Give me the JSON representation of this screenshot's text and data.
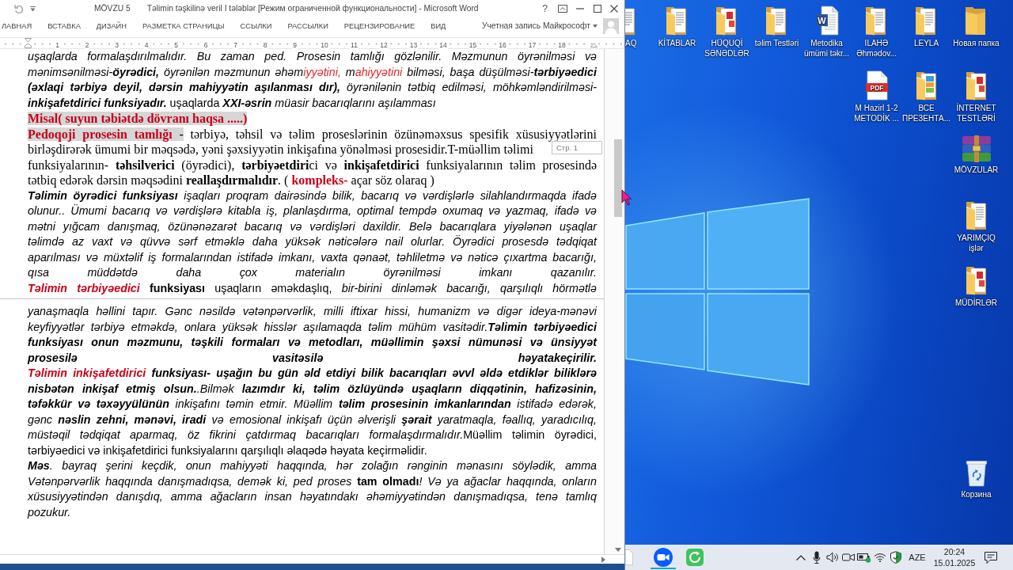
{
  "window": {
    "document_name": "MÖVZU 5",
    "title": "Təlimin təşkilinə veril I tələblər [Режим ограниченной функциональности] - Microsoft Word",
    "help": "?"
  },
  "ribbon_tabs": [
    {
      "label": "ЛАВНАЯ",
      "selected": false
    },
    {
      "label": "ВСТАВКА",
      "selected": false
    },
    {
      "label": "ДИЗАЙН",
      "selected": false
    },
    {
      "label": "РАЗМЕТКА СТРАНИЦЫ",
      "selected": false
    },
    {
      "label": "ССЫЛКИ",
      "selected": false
    },
    {
      "label": "РАССЫЛКИ",
      "selected": false
    },
    {
      "label": "РЕЦЕНЗИРОВАНИЕ",
      "selected": false
    },
    {
      "label": "ВИД",
      "selected": false
    }
  ],
  "account": {
    "label": "Учетная запись Майкрософт"
  },
  "ruler": [
    "1",
    "2",
    "3",
    "4",
    "5",
    "6",
    "7",
    "8",
    "9",
    "10",
    "11",
    "12",
    "13",
    "14",
    "15",
    "16",
    "17",
    "18"
  ],
  "document": {
    "pages": [
      {
        "paragraphs": [
          {
            "kind": "body",
            "continues_on_next_page": false,
            "lines": [
              {
                "runs": [
                  {
                    "kind": "italic",
                    "text": "uşaqlarda formalaşdırılmalıdır. Bu zaman ped. Prosesin tamlığı gözlənilir. Məzmunun öyrənilməsi və"
                  }
                ]
              },
              {
                "runs": [
                  {
                    "kind": "italic",
                    "text": "mənimsənilməsi-"
                  },
                  {
                    "kind": "bold-italic",
                    "text": "öyrədici,"
                  },
                  {
                    "kind": "italic",
                    "text": " öyrənilən məzmunun əhəm"
                  },
                  {
                    "kind": "red-italic",
                    "text": "iyyətini,"
                  },
                  {
                    "kind": "italic",
                    "text": " m"
                  },
                  {
                    "kind": "red-italic",
                    "text": "ahiyyətini"
                  },
                  {
                    "kind": "italic",
                    "text": " bilməsi, başa düşülməsi-"
                  },
                  {
                    "kind": "bold-italic",
                    "text": "tərbiyəedici"
                  }
                ]
              },
              {
                "runs": [
                  {
                    "kind": "bold-italic",
                    "text": "(əxlaqi tərbiyə deyil, dərsin mahiyyətin aşılanması dır),"
                  },
                  {
                    "kind": "italic",
                    "text": " öyrənilənin tətbiq edilməsi, möhkəmləndirilməsi-"
                  }
                ]
              },
              {
                "runs": [
                  {
                    "kind": "bold-italic",
                    "text": "inkişafetdirici funksiyadır."
                  },
                  {
                    "kind": "regular",
                    "text": " uşaqlarda "
                  },
                  {
                    "kind": "bold-italic",
                    "text": "XXI-əsrin"
                  },
                  {
                    "kind": "italic",
                    "text": " müasir bacarıqlarını aşılamması"
                  }
                ]
              }
            ]
          },
          {
            "kind": "example",
            "continues_on_next_page": false,
            "lines": [
              {
                "runs": [
                  {
                    "kind": "red-bold-highlighted",
                    "text": "Misal( suyun təbiətdə dövranı haqsa .....)"
                  }
                ]
              }
            ]
          },
          {
            "kind": "definition",
            "continues_on_next_page": false,
            "lines": [
              {
                "runs": [
                  {
                    "kind": "red-bold-highlighted",
                    "text": "Pedoqoji prosesin tamlığı"
                  },
                  {
                    "kind": "highlighted",
                    "text": " -"
                  },
                  {
                    "kind": "regular",
                    "text": " tərbiyə, təhsil və təlim proseslərinin özünəməxsus spesifik xüsusiyyətlərini"
                  }
                ]
              },
              {
                "runs": [
                  {
                    "kind": "regular",
                    "text": "birləşdirərək ümumi bir məqsədə, yəni şəxsiyyətin inkişafına yönəlməsi prosesidir.T-müəllim təlimi"
                  }
                ],
                "tooltip": "Стр. 1"
              },
              {
                "runs": [
                  {
                    "kind": "regular",
                    "text": "funksiyalarının- "
                  },
                  {
                    "kind": "bold",
                    "text": "təhsilverici"
                  },
                  {
                    "kind": "regular",
                    "text": " (öyrədici), "
                  },
                  {
                    "kind": "bold",
                    "text": "tərbiyəetdiri"
                  },
                  {
                    "kind": "regular",
                    "text": "ci və "
                  },
                  {
                    "kind": "bold",
                    "text": "inkişafetdirici"
                  },
                  {
                    "kind": "regular",
                    "text": " funksiyalarının təlim prosesində"
                  }
                ]
              },
              {
                "runs": [
                  {
                    "kind": "regular",
                    "text": "tətbiq edərək dərsin məqsədini "
                  },
                  {
                    "kind": "bold",
                    "text": "reallaşdırmalıdır"
                  },
                  {
                    "kind": "regular",
                    "text": ". ( "
                  },
                  {
                    "kind": "red-bold",
                    "text": "kompleks-"
                  },
                  {
                    "kind": "regular",
                    "text": " açar söz olaraq )"
                  }
                ]
              }
            ]
          },
          {
            "kind": "body",
            "continues_on_next_page": true,
            "lines": [
              {
                "runs": [
                  {
                    "kind": "bold-italic",
                    "text": "Təlimin öyrədici funksiyası"
                  },
                  {
                    "kind": "italic",
                    "text": " işaqları proqram dairəsində bilik, bacarıq və vərdişlərlə silahlandırmaqda ifadə"
                  }
                ]
              },
              {
                "runs": [
                  {
                    "kind": "italic",
                    "text": "olunur.. Ümumi bacarıq və vərdişlərə kitabla iş, planlaşdırma, optimal tempdə oxumaq və yazmaq, ifadə və"
                  }
                ]
              },
              {
                "runs": [
                  {
                    "kind": "italic",
                    "text": "mətni yığcam danışmaq, özünənəzarət bacarıq və vərdişləri daxildir. Belə bacarıqlara yiyələnən uşaqlar"
                  }
                ]
              },
              {
                "runs": [
                  {
                    "kind": "italic",
                    "text": "təlimdə az vaxt və qüvvə sərf etməklə daha yüksək nəticələrə nail olurlar. Öyrədici prosesdə tədqiqat"
                  }
                ]
              },
              {
                "runs": [
                  {
                    "kind": "italic",
                    "text": "aparılması və müxtəlif iş formalarından istifadə imkanı, vaxta qənaət, təhliletmə və nəticə çıxartma bacarığı,"
                  }
                ]
              },
              {
                "runs": [
                  {
                    "kind": "italic",
                    "text": "qısa müddətdə daha çox materialın öyrənilməsi imkanı qazanılır."
                  }
                ]
              },
              {
                "runs": [
                  {
                    "kind": "red-bold-italic",
                    "text": "Təlimin tərbiyəedici"
                  },
                  {
                    "kind": "bold",
                    "text": " funksiyası"
                  },
                  {
                    "kind": "regular",
                    "text": " uşaqların əməkdaşlıq,"
                  },
                  {
                    "kind": "italic",
                    "text": " bir-birini dinləmək bacarığı, qarşılıqlı hörmətlə"
                  }
                ]
              }
            ]
          }
        ]
      },
      {
        "paragraphs": [
          {
            "kind": "body",
            "continues_on_next_page": false,
            "lines": [
              {
                "runs": [
                  {
                    "kind": "italic",
                    "text": "yanaşmaqla həllini tapır. Gənc nəsildə vətənpərvərlik, milli iftixar hissi, humanizm və digər ideya-mənəvi"
                  }
                ]
              },
              {
                "runs": [
                  {
                    "kind": "italic",
                    "text": "keyfiyyətlər tərbiyə etməkdə, onlara yüksək hisslər aşılamaqda təlim mühüm vasitədir."
                  },
                  {
                    "kind": "bold-italic",
                    "text": "Təlimin tərbiyəedici"
                  }
                ]
              },
              {
                "runs": [
                  {
                    "kind": "bold-italic",
                    "text": "funksiyası onun məzmunu, təşkili formaları və metodları, müəllimin şəxsi nümunəsi və ünsiyyət"
                  }
                ]
              },
              {
                "runs": [
                  {
                    "kind": "bold-italic",
                    "text": "prosesilə vasitəsilə həyatakeçirilir."
                  }
                ]
              },
              {
                "runs": [
                  {
                    "kind": "red-bold-italic",
                    "text": "Təlimin inkişafetdirici"
                  },
                  {
                    "kind": "bold-italic",
                    "text": " funksiyası- uşağın bu gün əld etdiyi bilik bacarıqları əvvl əldə etdiklər biliklərə"
                  }
                ]
              },
              {
                "runs": [
                  {
                    "kind": "bold-italic",
                    "text": "nisbətən inkişaf etmiş olsun."
                  },
                  {
                    "kind": "italic",
                    "text": ".Bilmək "
                  },
                  {
                    "kind": "bold-italic",
                    "text": "lazımdır ki, təlim özlüyündə uşaqların diqqətinin, hafizəsinin,"
                  }
                ]
              },
              {
                "runs": [
                  {
                    "kind": "bold-italic",
                    "text": "təfəkkür və təxəyyülünün"
                  },
                  {
                    "kind": "italic",
                    "text": " inkişafını təmin etmir. Müəllim "
                  },
                  {
                    "kind": "bold-italic",
                    "text": "təlim prosesinin imkanlarından"
                  },
                  {
                    "kind": "italic",
                    "text": " istifadə edərək,"
                  }
                ]
              },
              {
                "runs": [
                  {
                    "kind": "italic",
                    "text": "gənc "
                  },
                  {
                    "kind": "bold-italic",
                    "text": "nəslin zehni, mənəvi, iradi"
                  },
                  {
                    "kind": "italic",
                    "text": " və emosional inkişafı üçün əlverişli "
                  },
                  {
                    "kind": "bold-italic",
                    "text": "şərait"
                  },
                  {
                    "kind": "italic",
                    "text": " yaratmaqla, fəallıq, yaradıcılıq,"
                  }
                ]
              },
              {
                "runs": [
                  {
                    "kind": "italic",
                    "text": "müstəqil tədqiqat aparmaq, öz fikrini çatdırmaq bacarıqları formalaşdırmalıdır."
                  },
                  {
                    "kind": "regular",
                    "text": "Müəllim təlimin öyrədici,"
                  }
                ]
              },
              {
                "runs": [
                  {
                    "kind": "regular",
                    "text": "tərbiyəedici və inkişafetdirici funksiyalarını qarşılıqlı əlaqədə həyata keçirməlidir."
                  }
                ]
              }
            ]
          },
          {
            "kind": "body",
            "continues_on_next_page": false,
            "lines": [
              {
                "runs": [
                  {
                    "kind": "bold-italic",
                    "text": "Məs"
                  },
                  {
                    "kind": "italic",
                    "text": ". bayraq şerini keçdik, onun mahiyyəti haqqında, hər zolağın rənginin mənasını söylədik, amma"
                  }
                ]
              },
              {
                "runs": [
                  {
                    "kind": "italic",
                    "text": "Vətənpərvərlik haqqında danışmadıqsa, demək ki, ped proses "
                  },
                  {
                    "kind": "bold",
                    "text": "tam olmadı"
                  },
                  {
                    "kind": "italic",
                    "text": "! Və ya ağaclar haqqında, onların"
                  }
                ]
              },
              {
                "runs": [
                  {
                    "kind": "italic",
                    "text": "xüsusiyyətindən danışdıq, amma ağacların insan həyatındakı əhəmiyyətindən danışmadıqsa, tenə tamlıq"
                  }
                ]
              },
              {
                "runs": [
                  {
                    "kind": "italic",
                    "text": "pozukur."
                  }
                ]
              }
            ]
          }
        ]
      }
    ]
  },
  "desktop": {
    "cut_icon": {
      "kind": "folder-docs",
      "label": "AQ"
    },
    "icon_rows": [
      [
        {
          "kind": "folder-docs",
          "label": "KİTABLAR"
        },
        {
          "kind": "folder-pdf",
          "label": "HÜQUQİ\nSƏNƏDLƏR"
        },
        {
          "kind": "folder-docs",
          "label": "təlim Testləri"
        },
        {
          "kind": "word-doc",
          "label": "Metodika\nümümi təkr...",
          "badge": "W"
        },
        {
          "kind": "folder-docs",
          "label": "ILAHƏ\nƏhmədov..."
        },
        {
          "kind": "folder-docs",
          "label": "LEYLA"
        },
        {
          "kind": "folder",
          "label": "Новая папка"
        }
      ],
      [
        {
          "kind": "pdf",
          "label": "M Hazirl 1-2\nMETODİK ...",
          "badge": "PDF"
        },
        {
          "kind": "folder-images",
          "label": "ВСЕ\nПРЕЗЕНТА..."
        },
        {
          "kind": "folder-pdf",
          "label": "İNTERNET\nTESTLƏRİ"
        }
      ],
      [
        {
          "kind": "archive",
          "label": "MÖVZULAR"
        }
      ],
      [
        {
          "kind": "folder-docs",
          "label": "YARIMÇIQ\nişlər"
        }
      ],
      [
        {
          "kind": "folder-pdf",
          "label": "MÜDİRLƏR"
        }
      ]
    ],
    "bottom_icons": [
      {
        "kind": "recycle-bin",
        "label": "Корзина"
      }
    ]
  },
  "taskbar": {
    "apps": [
      {
        "kind": "meeting",
        "running": true
      },
      {
        "kind": "recorder",
        "running": false
      }
    ],
    "language": "AZE",
    "time": "20:24",
    "date": "15.01.2025"
  }
}
